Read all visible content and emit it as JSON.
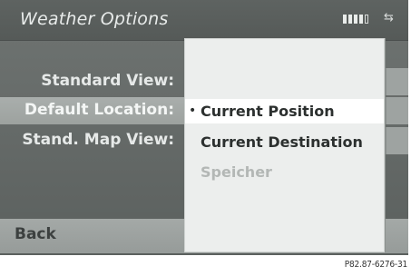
{
  "header": {
    "title": "Weather Options",
    "signal_icon": "signal-strength-icon",
    "network_icon": "network-arrows-icon",
    "network_glyph": "⇆"
  },
  "menu": {
    "items": [
      {
        "label": "Standard View:"
      },
      {
        "label": "Default Location:",
        "selected": true
      },
      {
        "label": "Stand. Map View:"
      }
    ],
    "back_label": "Back"
  },
  "popup": {
    "items": [
      {
        "label": "Current Position",
        "selected": true,
        "bullet": "•"
      },
      {
        "label": "Current Destination",
        "selected": false
      },
      {
        "label": "Speicher",
        "disabled": true
      }
    ]
  },
  "figure_code": "P82.87-6276-31",
  "colors": {
    "screen_bg": "#6f7472",
    "selected_row": "#a9aeac",
    "popup_bg": "#eceeed",
    "disabled_text": "#b3b7b5"
  }
}
